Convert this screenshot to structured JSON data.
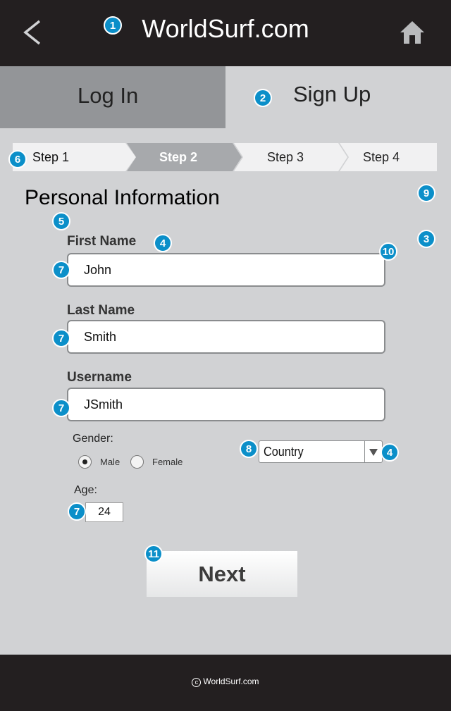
{
  "header": {
    "title": "WorldSurf.com",
    "back_icon": "chevron-left-icon",
    "home_icon": "home-icon"
  },
  "tabs": [
    {
      "label": "Log In",
      "active": false
    },
    {
      "label": "Sign Up",
      "active": true
    }
  ],
  "steps": [
    {
      "label": "Step 1",
      "state": "done"
    },
    {
      "label": "Step 2",
      "state": "current"
    },
    {
      "label": "Step 3",
      "state": "upcoming"
    },
    {
      "label": "Step 4",
      "state": "upcoming"
    }
  ],
  "form": {
    "section_title": "Personal Information",
    "first_name": {
      "label": "First Name",
      "value": "John"
    },
    "last_name": {
      "label": "Last Name",
      "value": "Smith"
    },
    "username": {
      "label": "Username",
      "value": "JSmith"
    },
    "gender": {
      "label": "Gender:",
      "options": [
        "Male",
        "Female"
      ],
      "selected": "Male"
    },
    "country": {
      "value": "Country"
    },
    "age": {
      "label": "Age:",
      "value": "24"
    },
    "next_label": "Next"
  },
  "footer": {
    "copyright": "WorldSurf.com",
    "copy_icon": "copyright-icon"
  },
  "annotations": [
    "1",
    "2",
    "3",
    "4",
    "4",
    "5",
    "6",
    "7",
    "7",
    "7",
    "7",
    "8",
    "9",
    "10",
    "11"
  ],
  "colors": {
    "header_bg": "#231f20",
    "page_bg": "#d1d2d4",
    "tab_inactive": "#939598",
    "step_active": "#a7a9ac",
    "step_inactive": "#f1f1f2",
    "marker": "#0b8fc9"
  }
}
